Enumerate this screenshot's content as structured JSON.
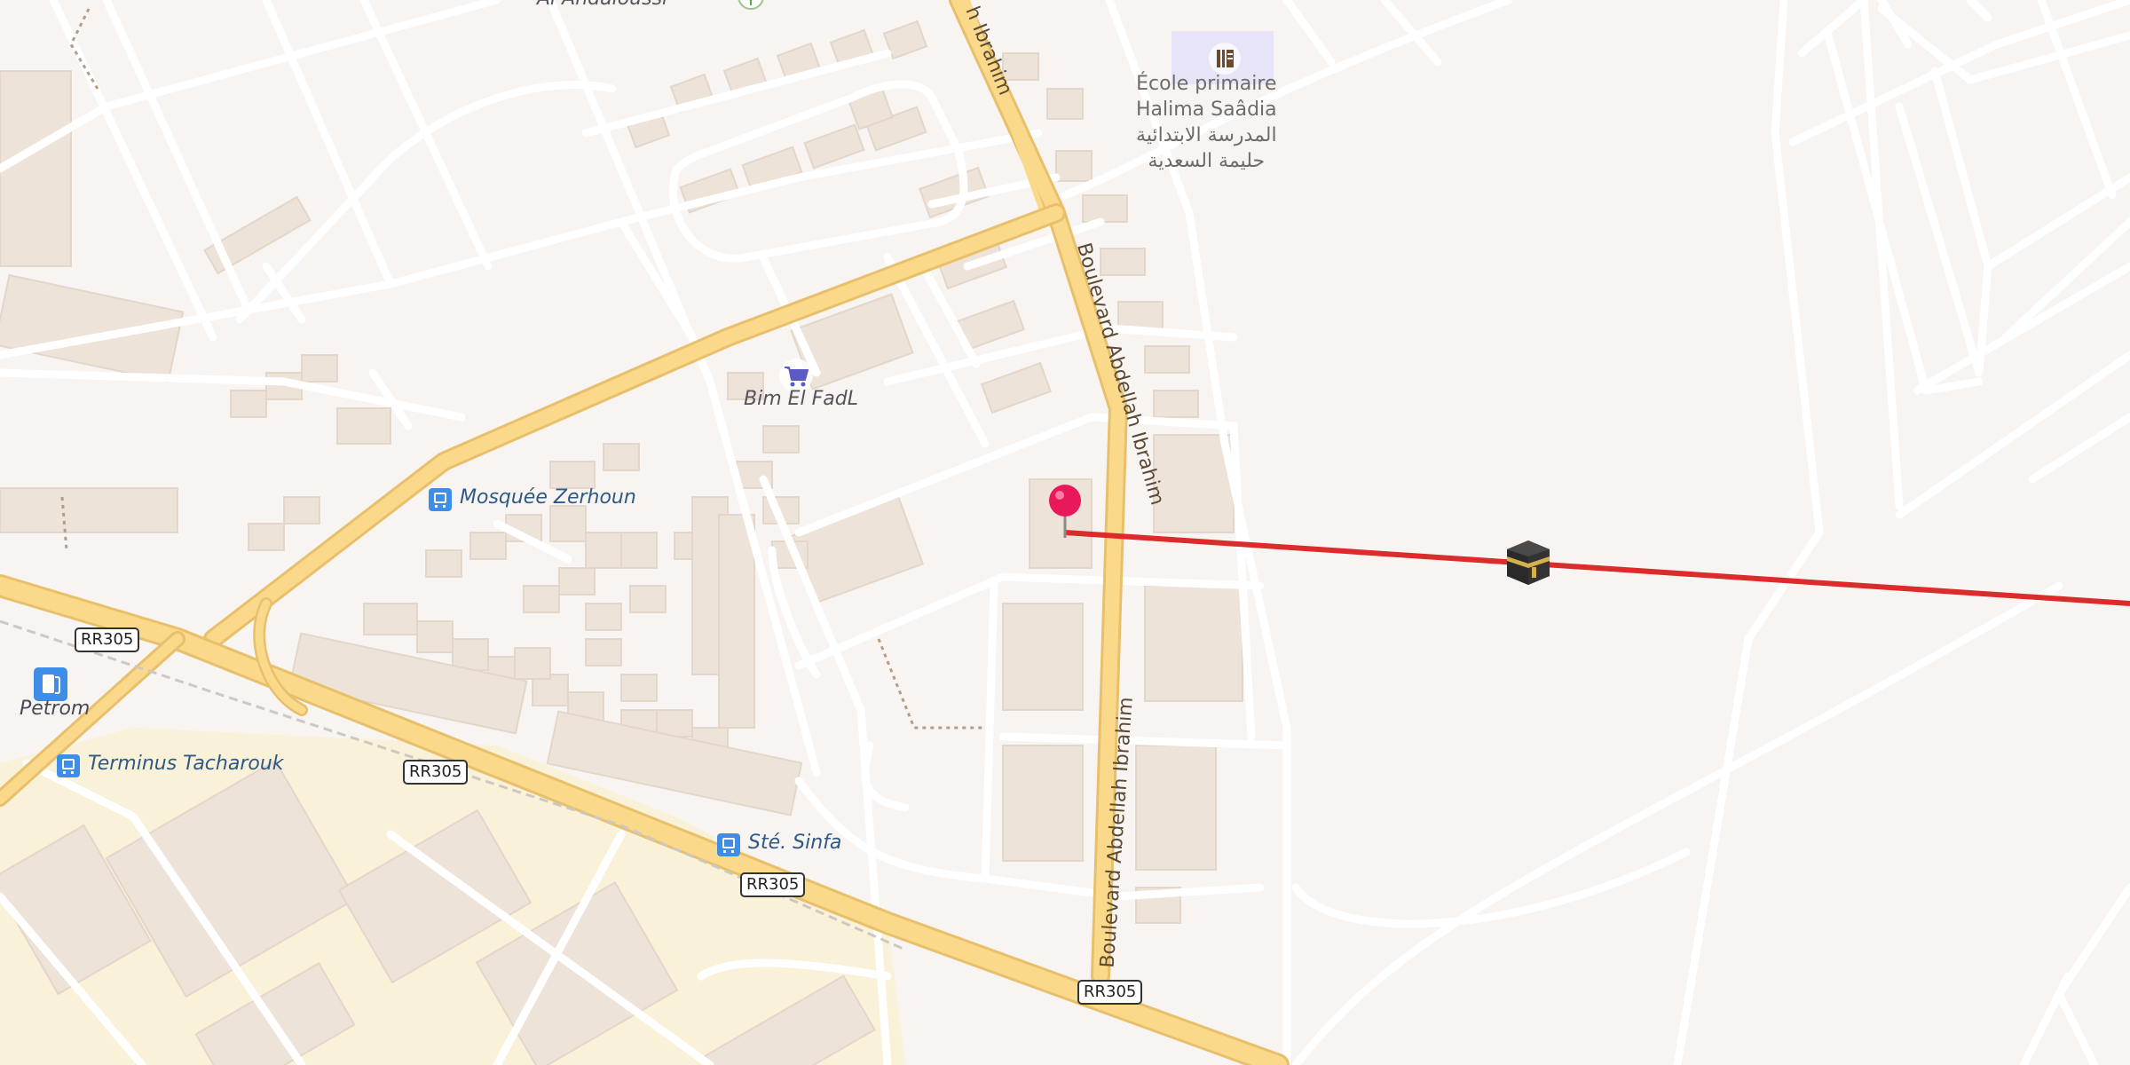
{
  "labels": {
    "top_cut": "Al Andaloussi",
    "school_fr_1": "École primaire",
    "school_fr_2": "Halima Saâdia",
    "school_ar_1": "المدرسة الابتدائية",
    "school_ar_2": "حليمة السعدية",
    "shop": "Bim El FadL",
    "bus_1": "Mosquée Zerhoun",
    "bus_2": "Terminus Tacharouk",
    "bus_3": "Sté. Sinfa",
    "fuel": "Petrom"
  },
  "streets": {
    "top": "h Ibrahim",
    "middle": "Boulevard Abdellah Ibrahim",
    "bottom": "Boulevard Abdellah Ibrahim"
  },
  "shields": {
    "a": "RR305",
    "b": "RR305",
    "c": "RR305",
    "d": "RR305"
  },
  "colors": {
    "background": "#f7f4f1",
    "minor_road": "#ffffff",
    "major_road": "#fbd98b",
    "industrial": "#faf1d9",
    "building": "#ede3d9",
    "qibla_line": "#dc2b2b",
    "pin": "#e8185a",
    "bus_icon": "#3e8ee8"
  },
  "icons": [
    "location-pin-icon",
    "kaaba-icon",
    "bus-stop-icon",
    "fuel-station-icon",
    "shopping-cart-icon",
    "school-icon"
  ]
}
